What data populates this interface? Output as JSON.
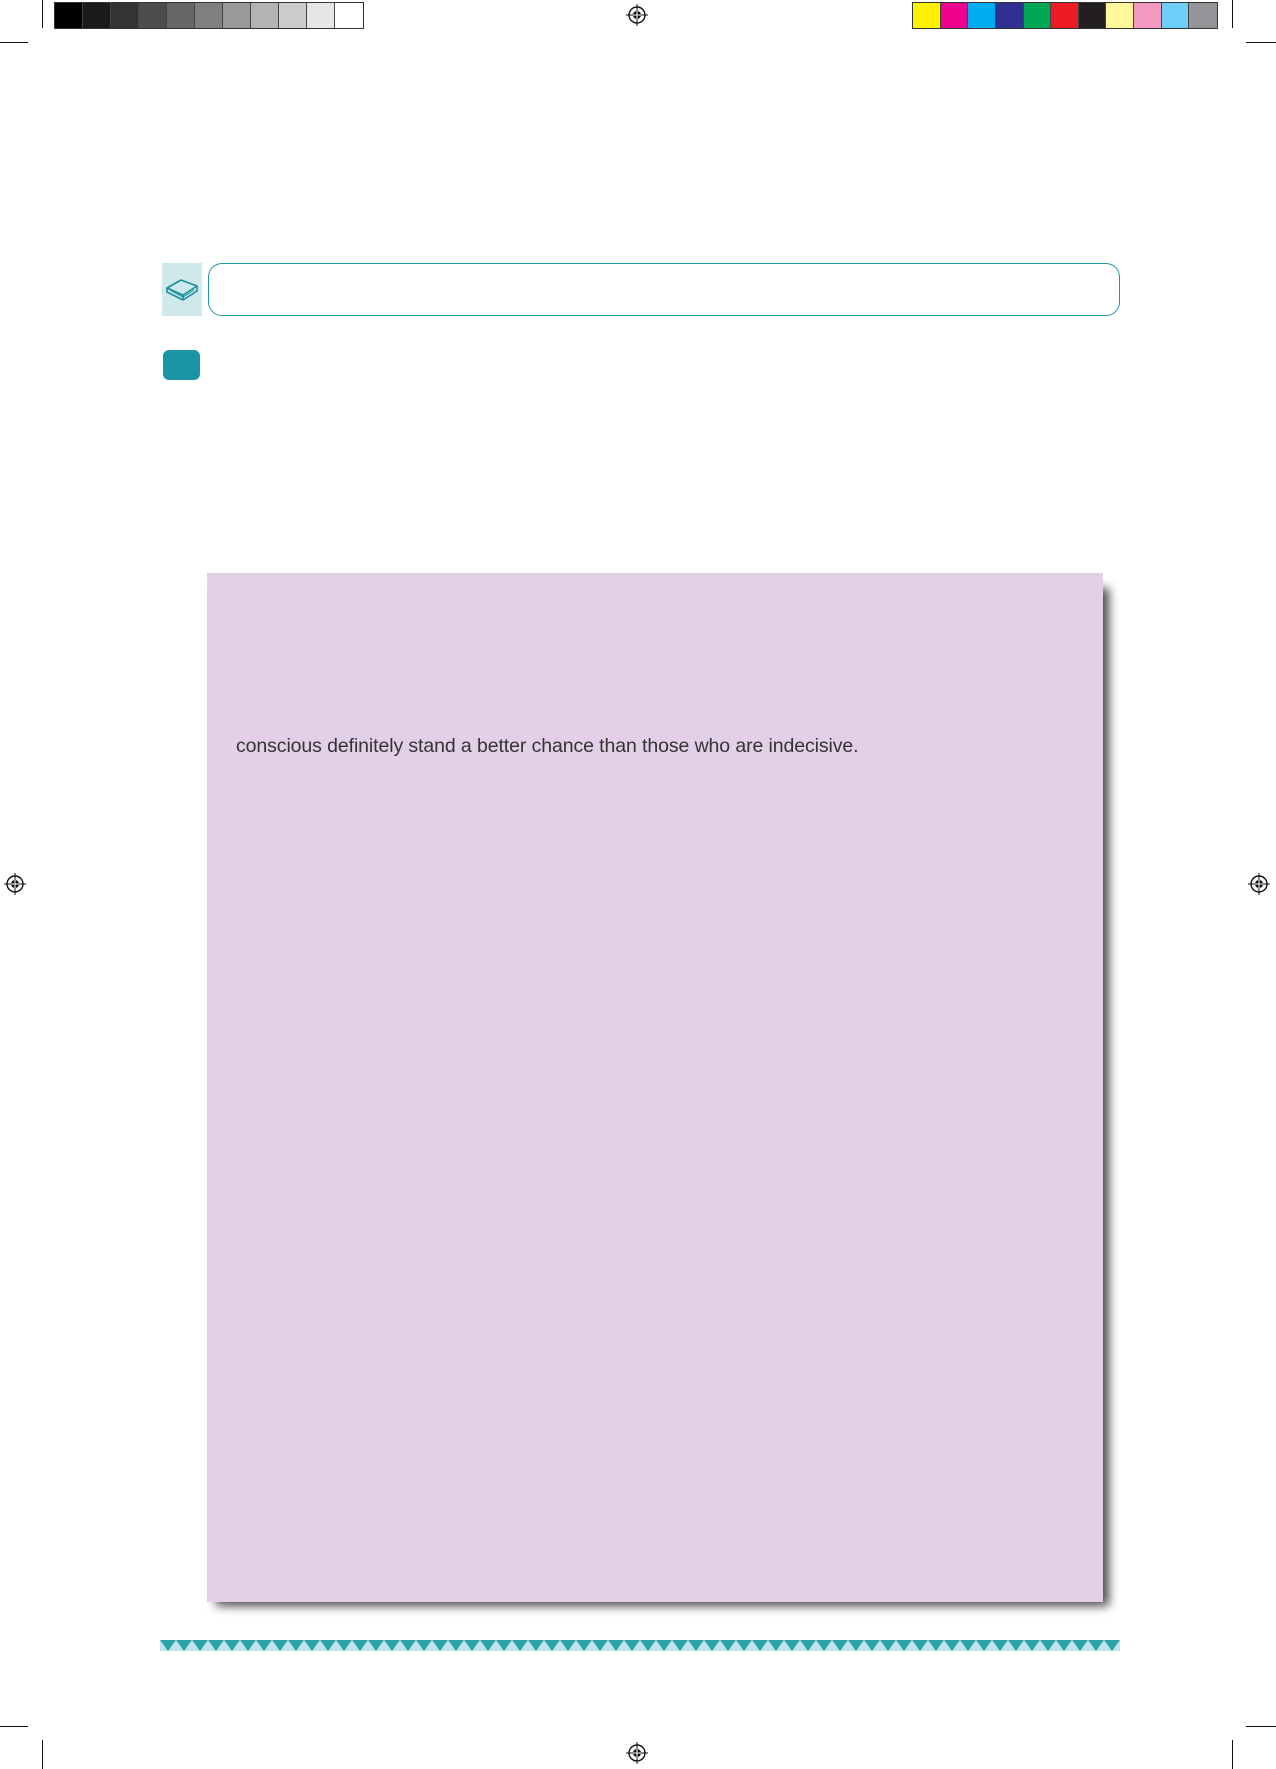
{
  "print_marks": {
    "gray_swatches": [
      "#000000",
      "#1a1a1a",
      "#333333",
      "#4d4d4d",
      "#666666",
      "#808080",
      "#999999",
      "#b3b3b3",
      "#cccccc",
      "#e6e6e6",
      "#ffffff"
    ],
    "color_swatches": [
      "#fff200",
      "#ec008c",
      "#00aeef",
      "#2e3192",
      "#00a651",
      "#ed1c24",
      "#231f20",
      "#fff799",
      "#f49ac1",
      "#6dcff6",
      "#939598"
    ]
  },
  "header": {
    "icon": "open-book-icon",
    "accent_color": "#1b95a3"
  },
  "panel": {
    "background_color": "#e3cfe7",
    "text": "conscious definitely stand a better chance than those who are indecisive."
  },
  "footer": {
    "strip_color": "#2aa3ad"
  }
}
